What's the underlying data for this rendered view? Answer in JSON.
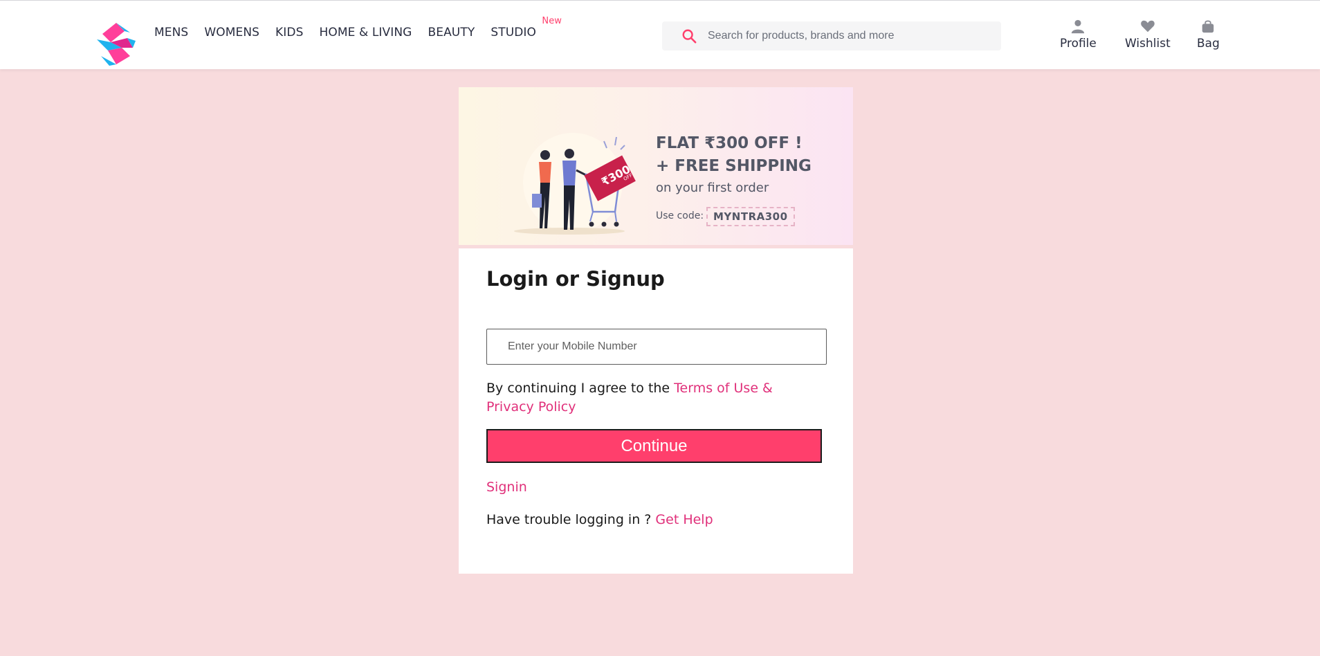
{
  "header": {
    "nav": [
      {
        "label": "MENS"
      },
      {
        "label": "WOMENS"
      },
      {
        "label": "KIDS"
      },
      {
        "label": "HOME & LIVING"
      },
      {
        "label": "BEAUTY"
      },
      {
        "label": "STUDIO",
        "badge": "New"
      }
    ],
    "search": {
      "placeholder": "Search for products, brands and more",
      "value": ""
    },
    "actions": {
      "profile": "Profile",
      "wishlist": "Wishlist",
      "bag": "Bag"
    }
  },
  "banner": {
    "line1": "FLAT ₹300 OFF !",
    "line2": "+ FREE SHIPPING",
    "line3": "on your first order",
    "code_label": "Use code:",
    "code": "MYNTRA300",
    "tag_text": "₹300",
    "tag_sub": "OFF"
  },
  "login": {
    "title": "Login or Signup",
    "mobile_placeholder": "Enter your Mobile Number",
    "mobile_value": "",
    "terms_prefix": "By continuing I agree to the ",
    "terms_link": "Terms of Use & Privacy Policy",
    "continue_label": "Continue",
    "signin_label": "Signin",
    "trouble_prefix": "Have trouble logging in ? ",
    "help_link": "Get Help"
  },
  "colors": {
    "accent": "#ff3f6c",
    "link": "#e0307a",
    "page_bg": "#f8dbdd",
    "text": "#282c3f"
  },
  "icons": {
    "logo": "myntra-logo",
    "search": "search-icon",
    "profile": "user-icon",
    "wishlist": "heart-icon",
    "bag": "bag-icon"
  }
}
